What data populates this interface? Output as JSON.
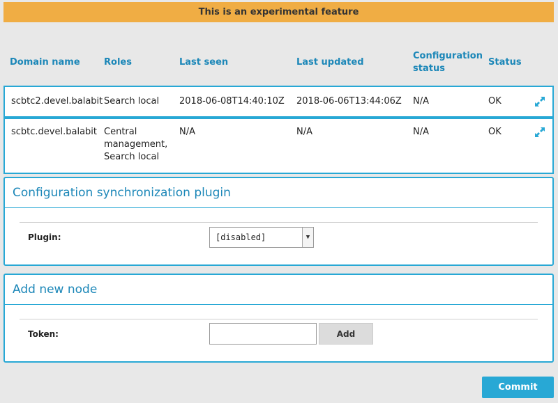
{
  "banner": {
    "text": "This is an experimental feature"
  },
  "table": {
    "headers": {
      "domain": "Domain name",
      "roles": "Roles",
      "last_seen": "Last seen",
      "last_updated": "Last updated",
      "config_status_1": "Configuration",
      "config_status_2": "status",
      "status": "Status"
    },
    "rows": [
      {
        "domain": "scbtc2.devel.balabit",
        "roles": [
          "Search local"
        ],
        "last_seen": "2018-06-08T14:40:10Z",
        "last_updated": "2018-06-06T13:44:06Z",
        "config_status": "N/A",
        "status": "OK",
        "action_icon": "expand-icon"
      },
      {
        "domain": "scbtc.devel.balabit",
        "roles": [
          "Central",
          "management,",
          "Search local"
        ],
        "last_seen": "N/A",
        "last_updated": "N/A",
        "config_status": "N/A",
        "status": "OK",
        "action_icon": "expand-icon"
      }
    ]
  },
  "config_plugin": {
    "title": "Configuration synchronization plugin",
    "plugin_label": "Plugin:",
    "plugin_value": "[disabled]"
  },
  "add_node": {
    "title": "Add new node",
    "token_label": "Token:",
    "token_value": "",
    "add_label": "Add"
  },
  "commit_label": "Commit",
  "colors": {
    "accent": "#28a8d5",
    "header_text": "#1c87b8",
    "banner": "#f0ad44"
  }
}
